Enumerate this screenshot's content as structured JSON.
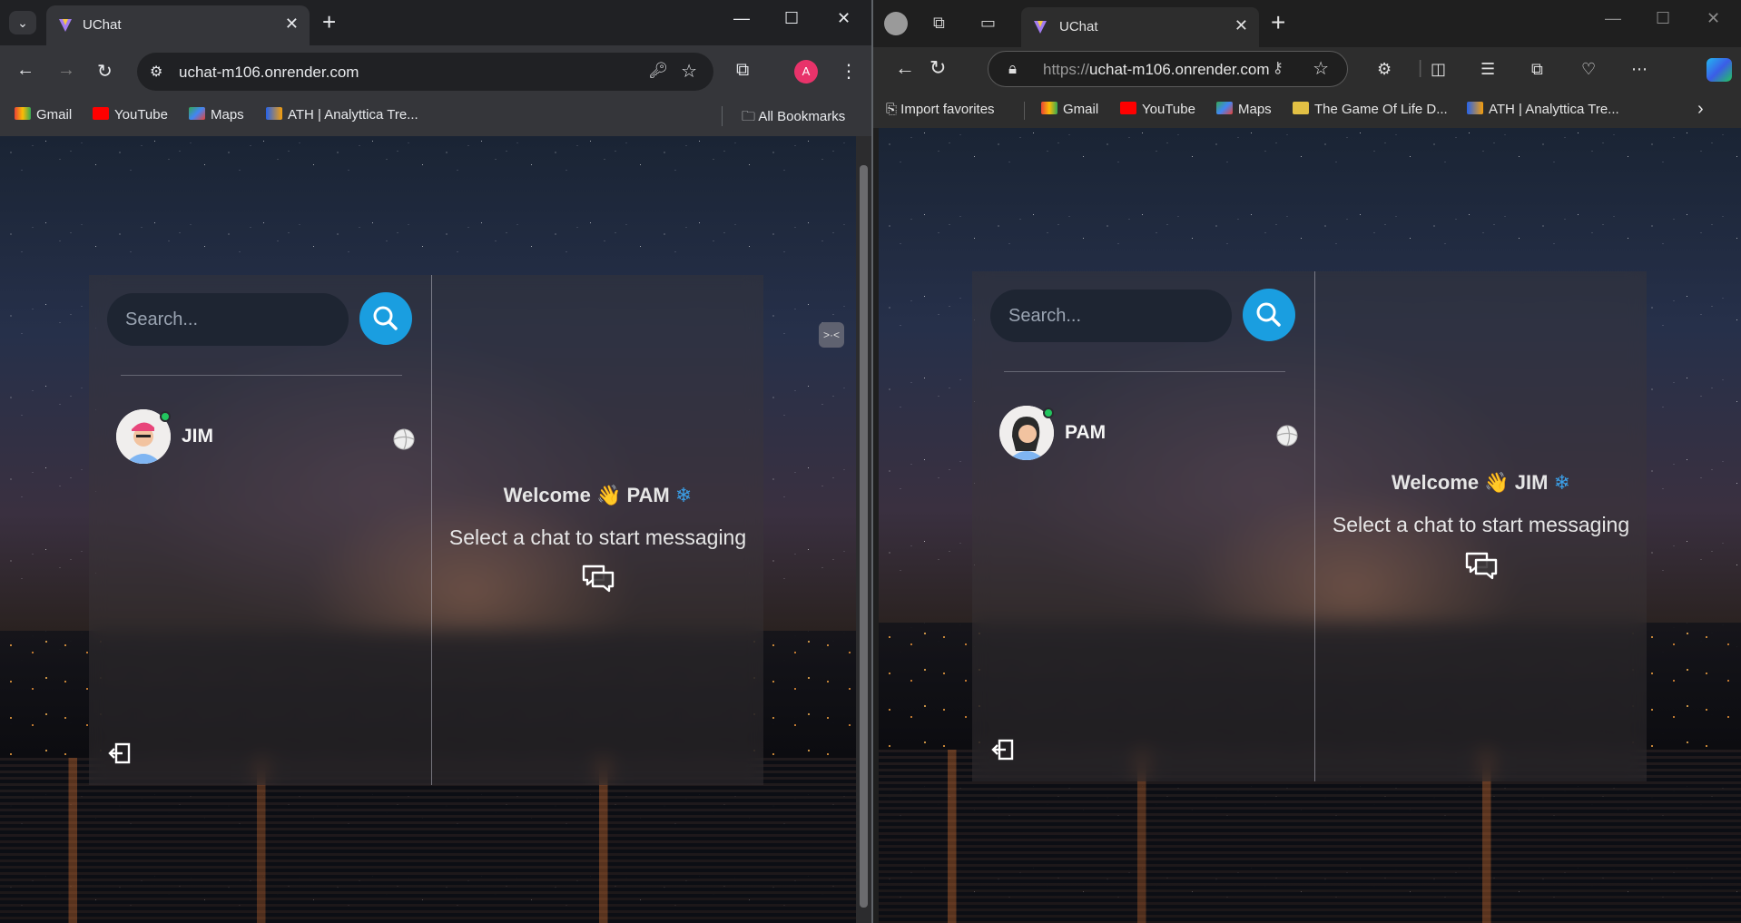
{
  "chrome": {
    "tab_title": "UChat",
    "url": "uchat-m106.onrender.com",
    "profile_initial": "A",
    "bookmarks": [
      "Gmail",
      "YouTube",
      "Maps",
      "ATH | Analyttica Tre..."
    ],
    "all_bookmarks": "All Bookmarks",
    "app": {
      "search_placeholder": "Search...",
      "contact_name": "JIM",
      "welcome": "Welcome",
      "welcome_name": "PAM",
      "subtitle": "Select a chat to start messaging"
    }
  },
  "edge": {
    "tab_title": "UChat",
    "url_protocol": "https://",
    "url_host": "uchat-m106.onrender.com",
    "import_favorites": "Import favorites",
    "bookmarks": [
      "Gmail",
      "YouTube",
      "Maps",
      "The Game Of Life D...",
      "ATH | Analyttica Tre..."
    ],
    "app": {
      "search_placeholder": "Search...",
      "contact_name": "PAM",
      "welcome": "Welcome",
      "welcome_name": "JIM",
      "subtitle": "Select a chat to start messaging"
    }
  },
  "icons": {
    "wave": "👋",
    "snowflake": "❄",
    "window_minimize": "—",
    "window_maximize": "☐",
    "window_close": "✕"
  },
  "colors": {
    "search_button": "#1a9ee0",
    "online_indicator": "#22c55e",
    "chrome_profile": "#e8336a"
  }
}
